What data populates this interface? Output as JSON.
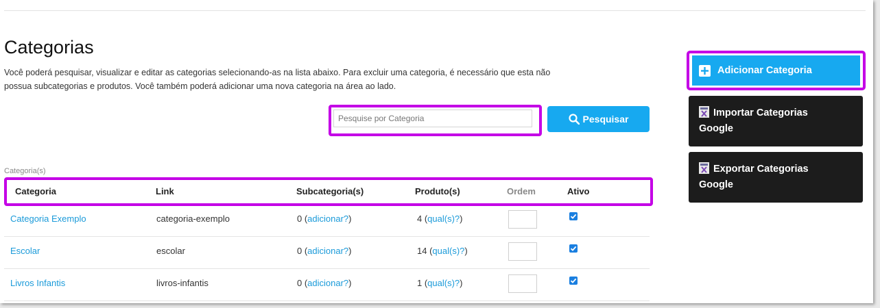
{
  "page": {
    "title": "Categorias",
    "description_line1": "Você poderá pesquisar, visualizar e editar as categorias selecionando-as na lista abaixo. Para excluir uma categoria, é necessário que esta não",
    "description_line2": "possua subcategorias e produtos. Você também poderá adicionar uma nova categoria na área ao lado."
  },
  "search": {
    "placeholder": "Pesquise por Categoria",
    "button_label": "Pesquisar"
  },
  "table": {
    "caption": "Categoria(s)",
    "headers": {
      "categoria": "Categoria",
      "link": "Link",
      "subcategorias": "Subcategoria(s)",
      "produtos": "Produto(s)",
      "ordem": "Ordem",
      "ativo": "Ativo"
    },
    "rows": [
      {
        "categoria": "Categoria Exemplo",
        "link": "categoria-exemplo",
        "sub_count": "0 (",
        "sub_link": "adicionar?",
        "prod_count": "4 (",
        "prod_link": "qual(s)?",
        "ativo": true
      },
      {
        "categoria": "Escolar",
        "link": "escolar",
        "sub_count": "0 (",
        "sub_link": "adicionar?",
        "prod_count": "14 (",
        "prod_link": "qual(s)?",
        "ativo": true
      },
      {
        "categoria": "Livros Infantis",
        "link": "livros-infantis",
        "sub_count": "0 (",
        "sub_link": "adicionar?",
        "prod_count": "1 (",
        "prod_link": "qual(s)?",
        "ativo": true
      }
    ],
    "close_paren": ")"
  },
  "sidebar": {
    "add_label": "Adicionar Categoria",
    "import_line1": "Importar Categorias",
    "import_line2": "Google",
    "export_line1": "Exportar Categorias",
    "export_line2": "Google"
  },
  "colors": {
    "accent": "#17a9f0",
    "highlight": "#c400e6",
    "dark_button": "#1c1c1c",
    "link": "#1a9ad9"
  }
}
